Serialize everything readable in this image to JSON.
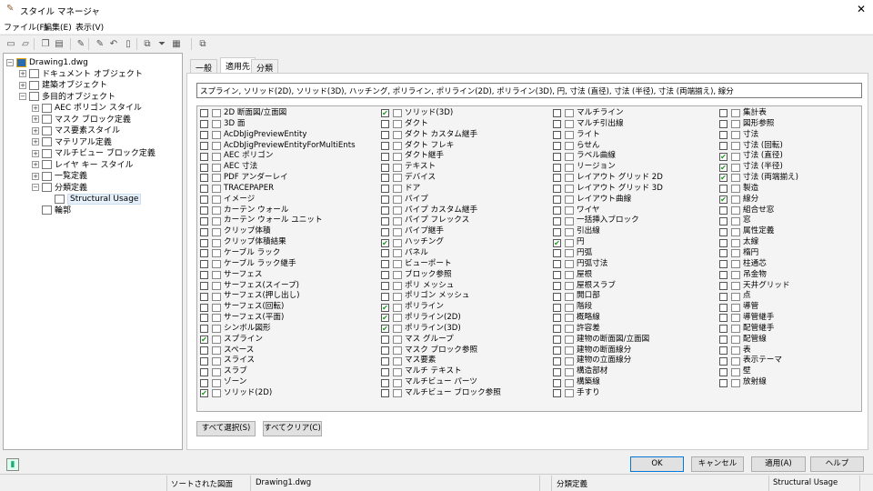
{
  "window": {
    "title": "スタイル マネージャ",
    "close": "✕"
  },
  "menu": [
    "ファイル(F)",
    "編集(E)",
    "表示(V)"
  ],
  "toolbar": {
    "icons": [
      "new-icon",
      "open-icon",
      "copy-icon",
      "paste-icon",
      "edit-style-icon",
      "purge-icon",
      "undo-icon",
      "sort-icon",
      "toggle-view-icon",
      "filter-icon",
      "view-icon",
      "help-icon"
    ]
  },
  "tree": [
    {
      "label": "Drawing1.dwg",
      "level": 0,
      "exp": "−"
    },
    {
      "label": "ドキュメント オブジェクト",
      "level": 1,
      "exp": "+"
    },
    {
      "label": "建築オブジェクト",
      "level": 1,
      "exp": "+"
    },
    {
      "label": "多目的オブジェクト",
      "level": 1,
      "exp": "−"
    },
    {
      "label": "AEC ポリゴン スタイル",
      "level": 2,
      "exp": "+"
    },
    {
      "label": "マスク ブロック定義",
      "level": 2,
      "exp": "+"
    },
    {
      "label": "マス要素スタイル",
      "level": 2,
      "exp": "+"
    },
    {
      "label": "マテリアル定義",
      "level": 2,
      "exp": "+"
    },
    {
      "label": "マルチビュー ブロック定義",
      "level": 2,
      "exp": "+"
    },
    {
      "label": "レイヤ キー スタイル",
      "level": 2,
      "exp": "+"
    },
    {
      "label": "一覧定義",
      "level": 2,
      "exp": "+"
    },
    {
      "label": "分類定義",
      "level": 2,
      "exp": "−"
    },
    {
      "label": "Structural Usage",
      "level": 3,
      "exp": "",
      "selected": true
    },
    {
      "label": "輪郭",
      "level": 2,
      "exp": ""
    }
  ],
  "tabs": [
    "一般",
    "適用先",
    "分類"
  ],
  "active_tab": 1,
  "applied_to": "スプライン, ソリッド(2D), ソリッド(3D), ハッチング, ポリライン, ポリライン(2D), ポリライン(3D), 円, 寸法 (直径), 寸法 (半径), 寸法 (両端揃え), 線分",
  "columns": [
    [
      [
        "2D 断面図/立面図",
        0
      ],
      [
        "3D 面",
        0
      ],
      [
        "AcDbJigPreviewEntity",
        0
      ],
      [
        "AcDbJigPreviewEntityForMultiEnts",
        0
      ],
      [
        "AEC ポリゴン",
        0
      ],
      [
        "AEC 寸法",
        0
      ],
      [
        "PDF アンダーレイ",
        0
      ],
      [
        "TRACEPAPER",
        0
      ],
      [
        "イメージ",
        0
      ],
      [
        "カーテン ウォール",
        0
      ],
      [
        "カーテン ウォール ユニット",
        0
      ],
      [
        "クリップ体積",
        0
      ],
      [
        "クリップ体積結果",
        0
      ],
      [
        "ケーブル ラック",
        0
      ],
      [
        "ケーブル ラック継手",
        0
      ],
      [
        "サーフェス",
        0
      ],
      [
        "サーフェス(スイープ)",
        0
      ],
      [
        "サーフェス(押し出し)",
        0
      ],
      [
        "サーフェス(回転)",
        0
      ],
      [
        "サーフェス(平面)",
        0
      ],
      [
        "シンボル図形",
        0
      ],
      [
        "スプライン",
        1
      ],
      [
        "スペース",
        0
      ],
      [
        "スライス",
        0
      ],
      [
        "スラブ",
        0
      ],
      [
        "ゾーン",
        0
      ],
      [
        "ソリッド(2D)",
        1
      ]
    ],
    [
      [
        "ソリッド(3D)",
        1
      ],
      [
        "ダクト",
        0
      ],
      [
        "ダクト カスタム継手",
        0
      ],
      [
        "ダクト フレキ",
        0
      ],
      [
        "ダクト継手",
        0
      ],
      [
        "テキスト",
        0
      ],
      [
        "デバイス",
        0
      ],
      [
        "ドア",
        0
      ],
      [
        "パイプ",
        0
      ],
      [
        "パイプ カスタム継手",
        0
      ],
      [
        "パイプ フレックス",
        0
      ],
      [
        "パイプ継手",
        0
      ],
      [
        "ハッチング",
        1
      ],
      [
        "パネル",
        0
      ],
      [
        "ビューポート",
        0
      ],
      [
        "ブロック参照",
        0
      ],
      [
        "ポリ メッシュ",
        0
      ],
      [
        "ポリゴン メッシュ",
        0
      ],
      [
        "ポリライン",
        1
      ],
      [
        "ポリライン(2D)",
        1
      ],
      [
        "ポリライン(3D)",
        1
      ],
      [
        "マス グループ",
        0
      ],
      [
        "マスク ブロック参照",
        0
      ],
      [
        "マス要素",
        0
      ],
      [
        "マルチ テキスト",
        0
      ],
      [
        "マルチビュー パーツ",
        0
      ],
      [
        "マルチビュー ブロック参照",
        0
      ]
    ],
    [
      [
        "マルチライン",
        0
      ],
      [
        "マルチ引出線",
        0
      ],
      [
        "ライト",
        0
      ],
      [
        "らせん",
        0
      ],
      [
        "ラベル曲線",
        0
      ],
      [
        "リージョン",
        0
      ],
      [
        "レイアウト グリッド 2D",
        0
      ],
      [
        "レイアウト グリッド 3D",
        0
      ],
      [
        "レイアウト曲線",
        0
      ],
      [
        "ワイヤ",
        0
      ],
      [
        "一括挿入ブロック",
        0
      ],
      [
        "引出線",
        0
      ],
      [
        "円",
        1
      ],
      [
        "円弧",
        0
      ],
      [
        "円弧寸法",
        0
      ],
      [
        "屋根",
        0
      ],
      [
        "屋根スラブ",
        0
      ],
      [
        "開口部",
        0
      ],
      [
        "階段",
        0
      ],
      [
        "概略線",
        0
      ],
      [
        "許容差",
        0
      ],
      [
        "建物の断面図/立面図",
        0
      ],
      [
        "建物の断面線分",
        0
      ],
      [
        "建物の立面線分",
        0
      ],
      [
        "構造部材",
        0
      ],
      [
        "構築線",
        0
      ],
      [
        "手すり",
        0
      ]
    ],
    [
      [
        "集計表",
        0
      ],
      [
        "図形参照",
        0
      ],
      [
        "寸法",
        0
      ],
      [
        "寸法 (回転)",
        0
      ],
      [
        "寸法 (直径)",
        1
      ],
      [
        "寸法 (半径)",
        1
      ],
      [
        "寸法 (両端揃え)",
        1
      ],
      [
        "製造",
        0
      ],
      [
        "線分",
        1
      ],
      [
        "組合せ窓",
        0
      ],
      [
        "窓",
        0
      ],
      [
        "属性定義",
        0
      ],
      [
        "太線",
        0
      ],
      [
        "楕円",
        0
      ],
      [
        "柱通芯",
        0
      ],
      [
        "吊金物",
        0
      ],
      [
        "天井グリッド",
        0
      ],
      [
        "点",
        0
      ],
      [
        "導管",
        0
      ],
      [
        "導管継手",
        0
      ],
      [
        "配管継手",
        0
      ],
      [
        "配管線",
        0
      ],
      [
        "表",
        0
      ],
      [
        "表示テーマ",
        0
      ],
      [
        "壁",
        0
      ],
      [
        "放射線",
        0
      ]
    ]
  ],
  "buttons": {
    "select_all": "すべて選択(S)",
    "clear_all": "すべてクリア(C)",
    "ok": "OK",
    "cancel": "キャンセル",
    "apply": "適用(A)",
    "help": "ヘルプ"
  },
  "status": {
    "sort": "ソートされた図面",
    "drawing": "Drawing1.dwg",
    "category": "分類定義",
    "style": "Structural Usage"
  }
}
